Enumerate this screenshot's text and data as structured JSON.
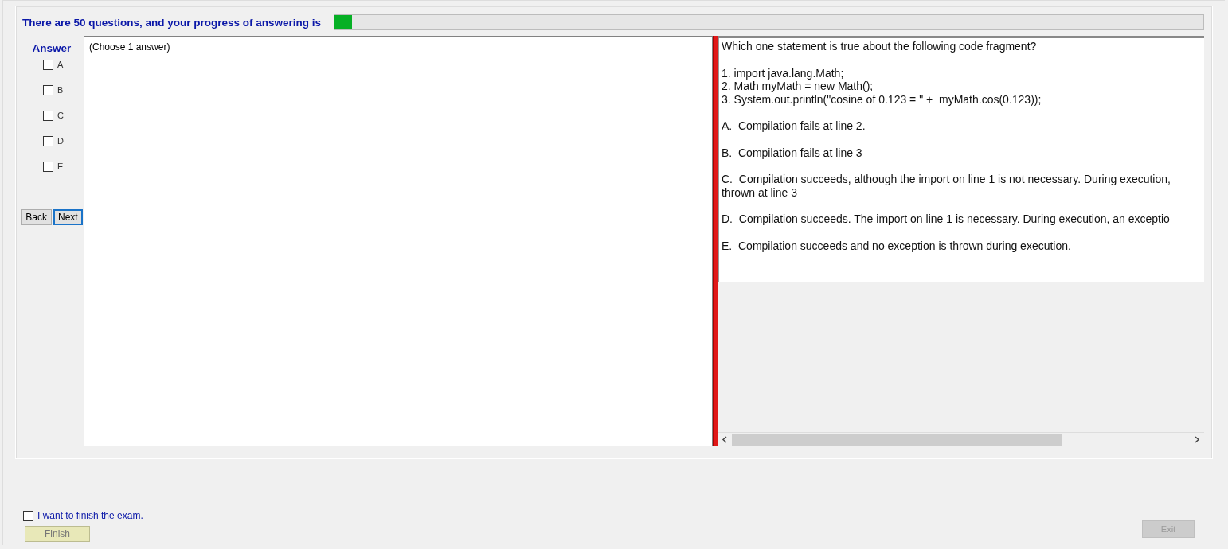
{
  "header": {
    "text": "There are 50 questions, and your progress of answering is",
    "progress": {
      "level": 0.02
    }
  },
  "answer": {
    "label": "Answer",
    "options": [
      {
        "label": "A",
        "checked": false
      },
      {
        "label": "B",
        "checked": false
      },
      {
        "label": "C",
        "checked": false
      },
      {
        "label": "D",
        "checked": false
      },
      {
        "label": "E",
        "checked": false
      }
    ]
  },
  "nav_buttons": [
    {
      "label": "Back",
      "focused": false
    },
    {
      "label": "Next",
      "focused": true
    }
  ],
  "instruction": "(Choose 1 answer)",
  "question": {
    "paragraphs": [
      [
        "Which one statement is true about the following code fragment?"
      ],
      [
        "1. import java.lang.Math;",
        "2. Math myMath = new Math();",
        "3. System.out.println(\"cosine of 0.123 = \" +  myMath.cos(0.123));"
      ],
      [
        "A.  Compilation fails at line 2."
      ],
      [
        "B.  Compilation fails at line 3"
      ],
      [
        "C.  Compilation succeeds, although the import on line 1 is not necessary. During execution,",
        "thrown at line 3"
      ],
      [
        "D.  Compilation succeeds. The import on line 1 is necessary. During execution, an exceptio"
      ],
      [
        "E.  Compilation succeeds and no exception is thrown during execution."
      ]
    ]
  },
  "finish": {
    "checkbox": {
      "label": "I want to finish the exam.",
      "checked": false
    },
    "button": {
      "label": "Finish",
      "disabled": true
    }
  },
  "exit_button": {
    "label": "Exit",
    "disabled": true
  }
}
